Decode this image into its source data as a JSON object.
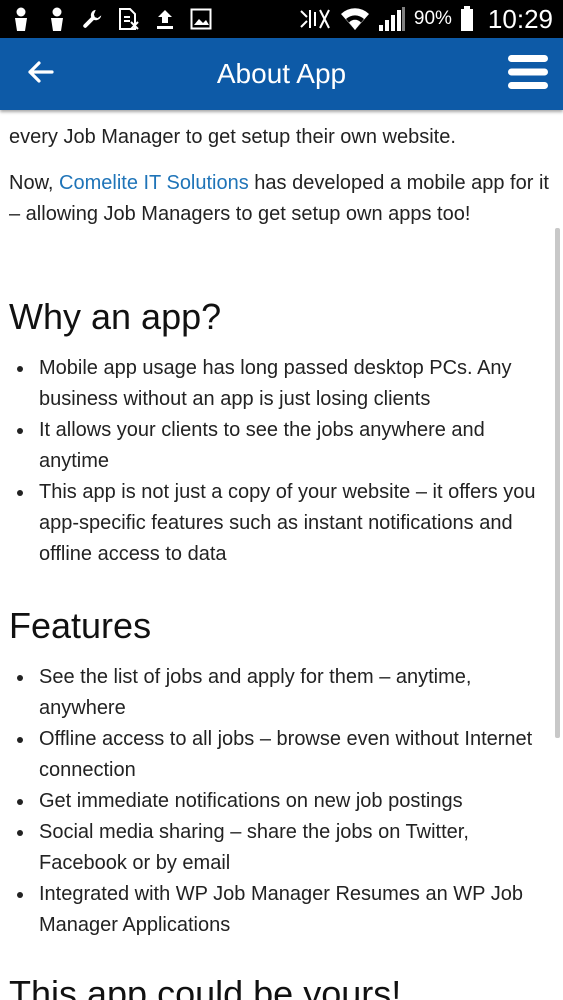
{
  "status_bar": {
    "icons_left": [
      "person-icon",
      "person-icon",
      "wrench-icon",
      "no-sim-icon",
      "upload-icon",
      "image-icon"
    ],
    "icons_right": [
      "nfc-icon",
      "wifi-icon",
      "signal-icon",
      "battery-icon"
    ],
    "battery": "90%",
    "time": "10:29"
  },
  "app_bar": {
    "title": "About App",
    "back_icon": "arrow-left-icon",
    "menu_icon": "hamburger-menu-icon",
    "color": "#0d5aa7"
  },
  "content": {
    "cut_line": "every Job Manager to get setup their own website.",
    "intro": {
      "before_link": "Now, ",
      "link": "Comelite IT Solutions",
      "after_link": " has developed a mobile app for it – allowing Job Managers to get setup own apps too!"
    },
    "why": {
      "heading": "Why an app?",
      "items": [
        "Mobile app usage has long passed desktop PCs. Any business without an app is just losing clients",
        "It allows your clients to see the jobs anywhere and anytime",
        "This app is not just a copy of your website – it offers you app-specific features such as instant notifications and offline access to data"
      ]
    },
    "features": {
      "heading": "Features",
      "items": [
        "See the list of jobs and apply for them – anytime, anywhere",
        "Offline access to all jobs – browse even without Internet connection",
        "Get immediate notifications on new job postings",
        "Social media sharing – share the jobs on Twitter, Facebook or by email",
        "Integrated with WP Job Manager Resumes an WP Job Manager Applications"
      ]
    },
    "yours_heading": "This app could be yours!",
    "link_color": "#1f74b8"
  }
}
